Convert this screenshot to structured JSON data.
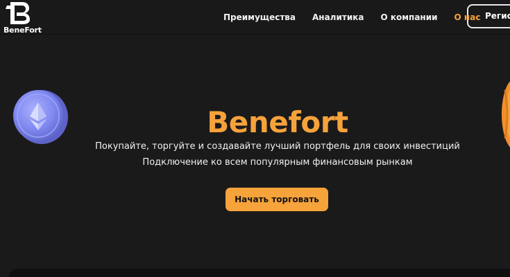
{
  "header": {
    "brand": "BeneFort",
    "nav": [
      {
        "label": "Преимущества"
      },
      {
        "label": "Аналитика"
      },
      {
        "label": "О компании"
      },
      {
        "label": "О нас"
      }
    ],
    "register_label": "Регистрация"
  },
  "hero": {
    "title": "Benefort",
    "line1": "Покупайте, торгуйте и создавайте лучший портфель для своих инвестиций",
    "line2": "Подключение ко всем популярным финансовым рынкам",
    "cta_label": "Начать торговать"
  },
  "icons": {
    "logo": "benefort-logo-icon",
    "left_coin": "ethereum-coin-icon",
    "right_coin": "gold-coin-icon"
  },
  "colors": {
    "background": "#1b1a1b",
    "accent": "#f6a23b",
    "coin_blue": "#7f88ef",
    "text": "#f3f3f3"
  }
}
